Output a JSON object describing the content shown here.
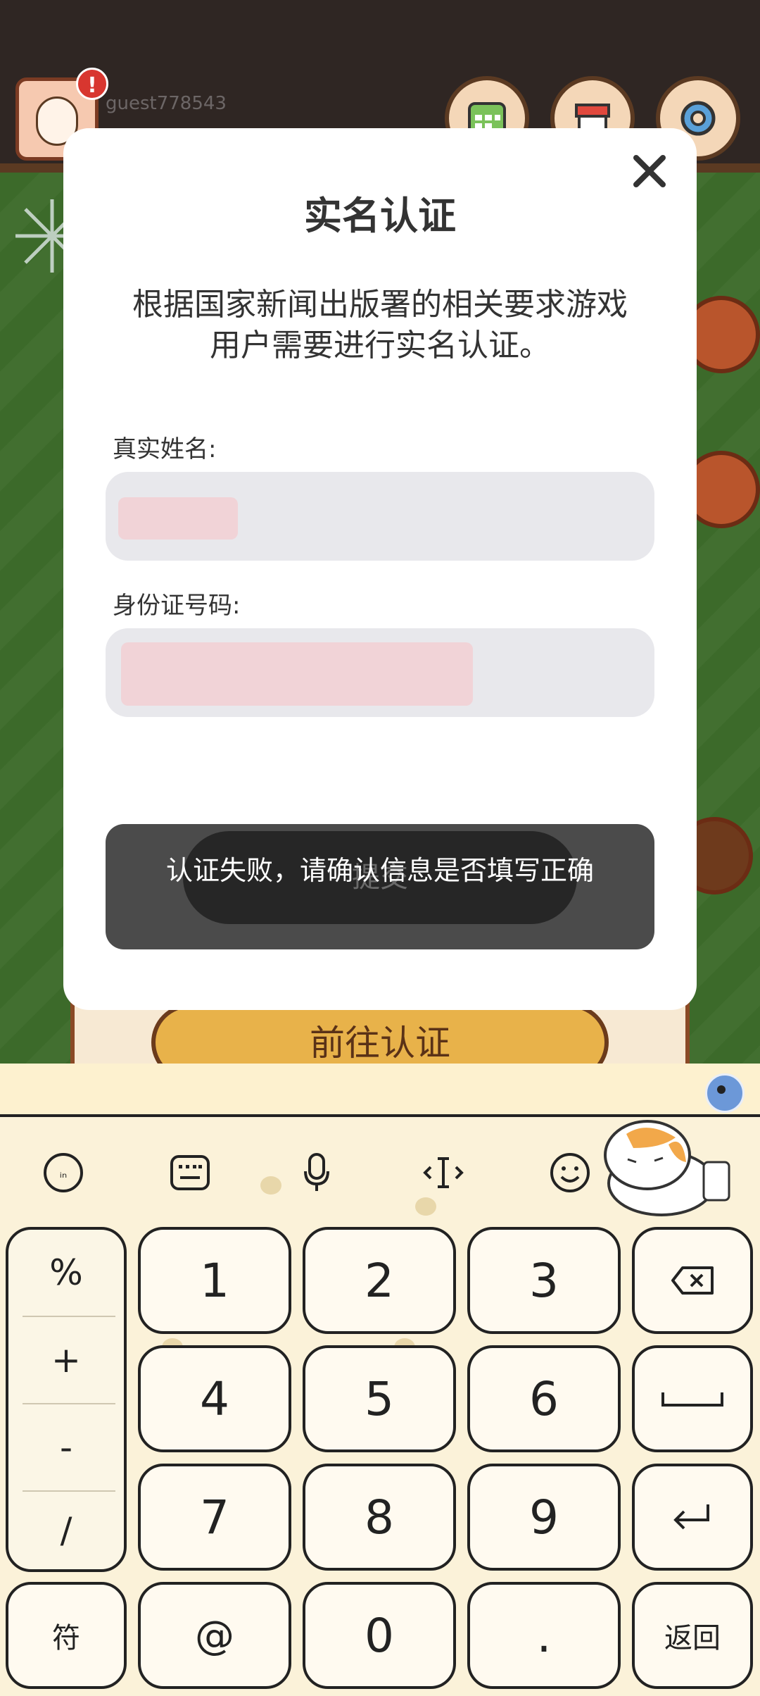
{
  "game": {
    "username": "guest778543",
    "alert_badge": "!",
    "goto_button": "前往认证"
  },
  "dialog": {
    "title": "实名认证",
    "description": "根据国家新闻出版署的相关要求游戏用户需要进行实名认证。",
    "name_label": "真实姓名:",
    "id_label": "身份证号码:",
    "submit_label": "提交",
    "toast": "认证失败，请确认信息是否填写正确"
  },
  "keyboard": {
    "symbols": [
      "%",
      "+",
      "-",
      "/"
    ],
    "rows": [
      [
        "1",
        "2",
        "3"
      ],
      [
        "4",
        "5",
        "6"
      ],
      [
        "7",
        "8",
        "9"
      ]
    ],
    "bottom": {
      "symbols_key": "符",
      "at_key": "@",
      "zero_key": "0",
      "dot_key": ".",
      "return_key": "返回"
    }
  },
  "colors": {
    "modal_bg": "#ffffff",
    "field_bg": "#e8e8ec",
    "toast_bg": "#4b4b4b",
    "keyboard_bg": "#fbf2d9",
    "goto_button": "#e8b24a"
  }
}
